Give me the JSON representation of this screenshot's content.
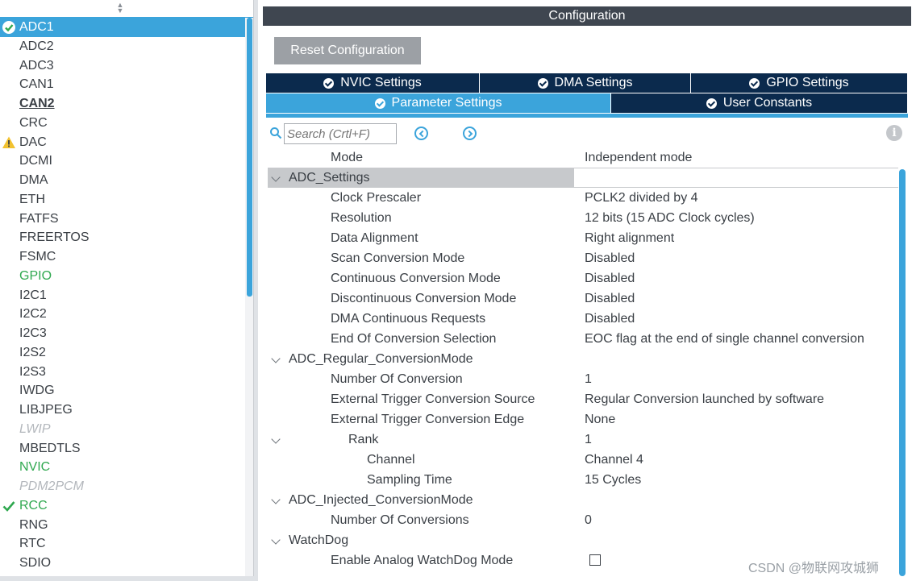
{
  "peripherals": [
    {
      "label": "ADC1",
      "state": "selected-ok"
    },
    {
      "label": "ADC2",
      "state": ""
    },
    {
      "label": "ADC3",
      "state": ""
    },
    {
      "label": "CAN1",
      "state": ""
    },
    {
      "label": "CAN2",
      "state": "bold"
    },
    {
      "label": "CRC",
      "state": ""
    },
    {
      "label": "DAC",
      "state": "warning"
    },
    {
      "label": "DCMI",
      "state": ""
    },
    {
      "label": "DMA",
      "state": ""
    },
    {
      "label": "ETH",
      "state": ""
    },
    {
      "label": "FATFS",
      "state": ""
    },
    {
      "label": "FREERTOS",
      "state": ""
    },
    {
      "label": "FSMC",
      "state": ""
    },
    {
      "label": "GPIO",
      "state": "green"
    },
    {
      "label": "I2C1",
      "state": ""
    },
    {
      "label": "I2C2",
      "state": ""
    },
    {
      "label": "I2C3",
      "state": ""
    },
    {
      "label": "I2S2",
      "state": ""
    },
    {
      "label": "I2S3",
      "state": ""
    },
    {
      "label": "IWDG",
      "state": ""
    },
    {
      "label": "LIBJPEG",
      "state": ""
    },
    {
      "label": "LWIP",
      "state": "disabled"
    },
    {
      "label": "MBEDTLS",
      "state": ""
    },
    {
      "label": "NVIC",
      "state": "green"
    },
    {
      "label": "PDM2PCM",
      "state": "disabled"
    },
    {
      "label": "RCC",
      "state": "green-check"
    },
    {
      "label": "RNG",
      "state": ""
    },
    {
      "label": "RTC",
      "state": ""
    },
    {
      "label": "SDIO",
      "state": ""
    }
  ],
  "config": {
    "title": "Configuration",
    "reset_label": "Reset Configuration",
    "tabs_top": [
      "NVIC Settings",
      "DMA Settings",
      "GPIO Settings"
    ],
    "tabs_bottom": [
      "Parameter Settings",
      "User Constants"
    ],
    "search_placeholder": "Search (Crtl+F)",
    "info_glyph": "i"
  },
  "params": [
    {
      "name": "Mode",
      "value": "Independent mode",
      "level": 1,
      "section": false
    },
    {
      "name": "ADC_Settings",
      "value": "",
      "level": 0,
      "section": true,
      "highlight": true
    },
    {
      "name": "Clock Prescaler",
      "value": "PCLK2 divided by 4",
      "level": 1,
      "section": false
    },
    {
      "name": "Resolution",
      "value": "12 bits (15 ADC Clock cycles)",
      "level": 1,
      "section": false
    },
    {
      "name": "Data Alignment",
      "value": "Right alignment",
      "level": 1,
      "section": false
    },
    {
      "name": "Scan Conversion Mode",
      "value": "Disabled",
      "level": 1,
      "section": false
    },
    {
      "name": "Continuous Conversion Mode",
      "value": "Disabled",
      "level": 1,
      "section": false
    },
    {
      "name": "Discontinuous Conversion Mode",
      "value": "Disabled",
      "level": 1,
      "section": false
    },
    {
      "name": "DMA Continuous Requests",
      "value": "Disabled",
      "level": 1,
      "section": false
    },
    {
      "name": "End Of Conversion Selection",
      "value": "EOC flag at the end of single channel conversion",
      "level": 1,
      "section": false
    },
    {
      "name": "ADC_Regular_ConversionMode",
      "value": "",
      "level": 0,
      "section": true
    },
    {
      "name": "Number Of Conversion",
      "value": "1",
      "level": 1,
      "section": false
    },
    {
      "name": "External Trigger Conversion Source",
      "value": "Regular Conversion launched by software",
      "level": 1,
      "section": false
    },
    {
      "name": "External Trigger Conversion Edge",
      "value": "None",
      "level": 1,
      "section": false
    },
    {
      "name": "Rank",
      "value": "1",
      "level": 2,
      "section": true,
      "chevron_only": true
    },
    {
      "name": "Channel",
      "value": "Channel 4",
      "level": 3,
      "section": false
    },
    {
      "name": "Sampling Time",
      "value": "15 Cycles",
      "level": 3,
      "section": false
    },
    {
      "name": "ADC_Injected_ConversionMode",
      "value": "",
      "level": 0,
      "section": true
    },
    {
      "name": "Number Of Conversions",
      "value": "0",
      "level": 1,
      "section": false
    },
    {
      "name": "WatchDog",
      "value": "",
      "level": 0,
      "section": true
    },
    {
      "name": "Enable Analog WatchDog Mode",
      "value": "",
      "level": 1,
      "section": false,
      "checkbox": true
    }
  ],
  "watermark": "CSDN @物联网攻城狮",
  "colors": {
    "accent": "#3ba4db",
    "tab_dark": "#0b2a4d",
    "ok_green": "#2fa84f",
    "warning": "#f2c230"
  }
}
